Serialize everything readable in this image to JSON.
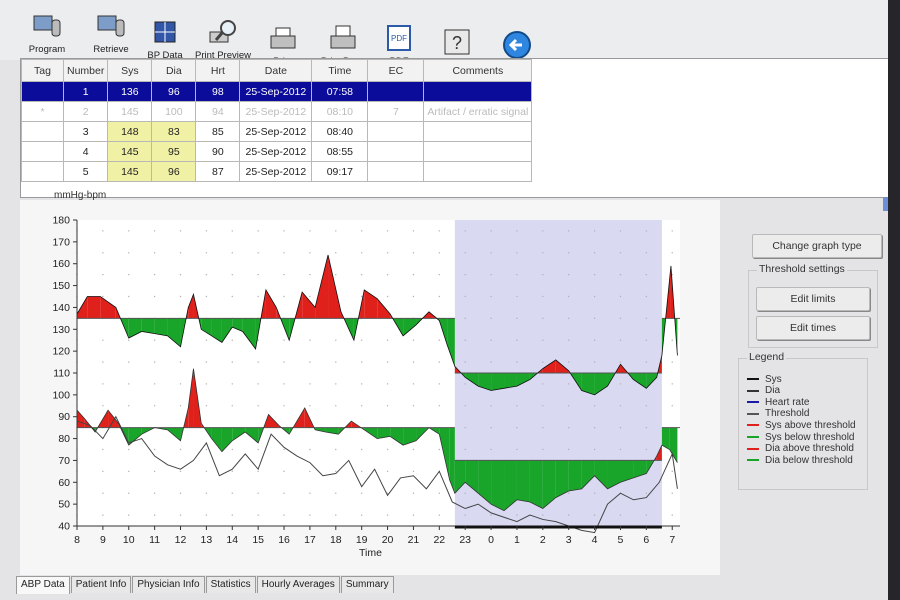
{
  "toolbar": {
    "buttons": [
      {
        "label": "Program",
        "icon": "program-icon"
      },
      {
        "label": "Retrieve",
        "icon": "retrieve-icon"
      },
      {
        "label": "BP Data",
        "icon": "bp-data-icon"
      },
      {
        "label": "Print Preview",
        "icon": "print-preview-icon"
      },
      {
        "label": "Print",
        "icon": "print-icon"
      },
      {
        "label": "Print Page",
        "icon": "print-page-icon"
      },
      {
        "label": "PDF",
        "icon": "pdf-icon"
      },
      {
        "label": "Help",
        "icon": "help-icon"
      },
      {
        "label": "Exit",
        "icon": "exit-icon"
      }
    ]
  },
  "table": {
    "columns": [
      "Tag",
      "Number",
      "Sys",
      "Dia",
      "Hrt",
      "Date",
      "Time",
      "EC",
      "Comments"
    ],
    "rows": [
      {
        "tag": "",
        "number": "1",
        "sys": "136",
        "dia": "96",
        "hrt": "98",
        "date": "25-Sep-2012",
        "time": "07:58",
        "ec": "",
        "comment": "",
        "state": "selected"
      },
      {
        "tag": "*",
        "number": "2",
        "sys": "145",
        "dia": "100",
        "hrt": "94",
        "date": "25-Sep-2012",
        "time": "08:10",
        "ec": "7",
        "comment": "Artifact / erratic signal",
        "state": "faded"
      },
      {
        "tag": "",
        "number": "3",
        "sys": "148",
        "dia": "83",
        "hrt": "85",
        "date": "25-Sep-2012",
        "time": "08:40",
        "ec": "",
        "comment": "",
        "state": "normal"
      },
      {
        "tag": "",
        "number": "4",
        "sys": "145",
        "dia": "95",
        "hrt": "90",
        "date": "25-Sep-2012",
        "time": "08:55",
        "ec": "",
        "comment": "",
        "state": "normal"
      },
      {
        "tag": "",
        "number": "5",
        "sys": "145",
        "dia": "96",
        "hrt": "87",
        "date": "25-Sep-2012",
        "time": "09:17",
        "ec": "",
        "comment": "",
        "state": "normal"
      }
    ]
  },
  "colors": {
    "above": "#e0201b",
    "below": "#19a52a",
    "sys": "#111111",
    "dia": "#333333",
    "heart_rate": "#1a1aa8",
    "threshold": "#555555",
    "night_band": "#d9d9f2",
    "selected_row": "#0b0c9a",
    "highlight_cell": "#f1f1a6"
  },
  "chart_data": {
    "type": "area",
    "ylabel": "mmHg-bpm",
    "xlabel": "Time",
    "ylim": [
      40,
      180
    ],
    "yticks": [
      40,
      50,
      60,
      70,
      80,
      90,
      100,
      110,
      120,
      130,
      140,
      150,
      160,
      170,
      180
    ],
    "xlim": [
      8,
      31.3
    ],
    "xtick_values": [
      8,
      9,
      10,
      11,
      12,
      13,
      14,
      15,
      16,
      17,
      18,
      19,
      20,
      21,
      22,
      23,
      24,
      25,
      26,
      27,
      28,
      29,
      30,
      31
    ],
    "xtick_labels": [
      "8",
      "9",
      "10",
      "11",
      "12",
      "13",
      "14",
      "15",
      "16",
      "17",
      "18",
      "19",
      "20",
      "21",
      "22",
      "23",
      "0",
      "1",
      "2",
      "3",
      "4",
      "5",
      "6",
      "7"
    ],
    "night_period": [
      22.6,
      30.6
    ],
    "thresholds": [
      {
        "series": "Sys",
        "segments": [
          {
            "x": [
              8,
              22.6
            ],
            "y": 135
          },
          {
            "x": [
              22.6,
              30.6
            ],
            "y": 110
          },
          {
            "x": [
              30.6,
              31.3
            ],
            "y": 135
          }
        ]
      },
      {
        "series": "Dia",
        "segments": [
          {
            "x": [
              8,
              22.6
            ],
            "y": 85
          },
          {
            "x": [
              22.6,
              30.6
            ],
            "y": 70
          },
          {
            "x": [
              30.6,
              31.3
            ],
            "y": 85
          }
        ]
      }
    ],
    "series": [
      {
        "name": "Sys",
        "x": [
          8,
          8.4,
          8.9,
          9.5,
          10,
          10.5,
          11,
          11.5,
          12,
          12.3,
          12.5,
          12.8,
          13.2,
          13.6,
          14,
          14.4,
          14.9,
          15.3,
          15.7,
          16.2,
          16.7,
          17.2,
          17.7,
          18.2,
          18.7,
          19.1,
          19.6,
          20.1,
          20.6,
          21.1,
          21.6,
          22,
          22.3,
          22.6,
          23,
          23.5,
          24,
          24.5,
          25,
          25.5,
          26,
          26.5,
          27,
          27.5,
          28,
          28.5,
          29,
          29.5,
          30,
          30.4,
          30.6,
          30.95,
          31.2
        ],
        "y": [
          137,
          145,
          145,
          140,
          126,
          129,
          128,
          127,
          122,
          140,
          146,
          130,
          127,
          124,
          131,
          129,
          121,
          148,
          140,
          125,
          147,
          140,
          164,
          138,
          125,
          148,
          144,
          137,
          127,
          132,
          138,
          134,
          123,
          113,
          108,
          104,
          102,
          103,
          104,
          107,
          112,
          116,
          111,
          102,
          100,
          104,
          114,
          107,
          103,
          108,
          118,
          159,
          118
        ]
      },
      {
        "name": "Dia",
        "x": [
          8,
          8.3,
          8.7,
          9.2,
          9.6,
          10,
          10.5,
          11,
          11.5,
          12,
          12.3,
          12.5,
          12.8,
          13.2,
          13.6,
          14,
          14.5,
          15,
          15.4,
          15.8,
          16.2,
          16.8,
          17.2,
          17.6,
          18.1,
          18.6,
          19.1,
          19.6,
          20.1,
          20.6,
          21.1,
          21.6,
          22,
          22.4,
          22.6,
          23,
          23.5,
          24,
          24.5,
          25,
          25.5,
          26,
          26.5,
          27,
          27.5,
          28,
          28.5,
          29,
          29.5,
          30,
          30.4,
          30.6,
          30.9,
          31.2
        ],
        "y": [
          93,
          89,
          83,
          93,
          87,
          77,
          82,
          85,
          84,
          79,
          94,
          112,
          87,
          80,
          74,
          79,
          83,
          78,
          91,
          86,
          82,
          94,
          84,
          83,
          82,
          88,
          84,
          80,
          81,
          77,
          79,
          85,
          82,
          61,
          55,
          60,
          55,
          50,
          47,
          52,
          51,
          48,
          53,
          56,
          57,
          63,
          57,
          60,
          62,
          64,
          72,
          77,
          75,
          69
        ]
      },
      {
        "name": "Heart rate",
        "x": [
          8,
          8.5,
          9,
          9.5,
          10,
          10.5,
          11,
          11.5,
          12,
          12.5,
          13,
          13.5,
          14,
          14.5,
          15,
          15.5,
          16,
          16.5,
          17,
          17.5,
          18,
          18.5,
          19,
          19.5,
          20,
          20.5,
          21,
          21.5,
          22,
          22.5,
          23,
          23.5,
          24,
          24.5,
          25,
          25.5,
          26,
          26.5,
          27,
          27.5,
          28,
          28.5,
          29,
          29.5,
          30,
          30.5,
          31,
          31.2
        ],
        "y": [
          88,
          86,
          80,
          90,
          78,
          80,
          72,
          68,
          66,
          70,
          78,
          63,
          66,
          73,
          66,
          82,
          76,
          72,
          69,
          63,
          64,
          70,
          58,
          66,
          54,
          62,
          63,
          57,
          65,
          51,
          48,
          50,
          46,
          44,
          42,
          45,
          43,
          42,
          40,
          38,
          37,
          50,
          55,
          52,
          53,
          60,
          73,
          57
        ]
      }
    ]
  },
  "right_panel": {
    "change_graph_button": "Change graph type",
    "threshold_title": "Threshold settings",
    "edit_limits_button": "Edit limits",
    "edit_times_button": "Edit times",
    "legend_title": "Legend",
    "legend": [
      {
        "label": "Sys",
        "color": "#111111"
      },
      {
        "label": "Dia",
        "color": "#333333"
      },
      {
        "label": "Heart rate",
        "color": "#1a1aa8"
      },
      {
        "label": "Threshold",
        "color": "#555555"
      },
      {
        "label": "Sys above threshold",
        "color": "#e0201b"
      },
      {
        "label": "Sys below threshold",
        "color": "#19a52a"
      },
      {
        "label": "Dia above threshold",
        "color": "#e0201b"
      },
      {
        "label": "Dia below threshold",
        "color": "#19a52a"
      }
    ]
  },
  "tabs": [
    "ABP Data",
    "Patient Info",
    "Physician Info",
    "Statistics",
    "Hourly Averages",
    "Summary"
  ],
  "active_tab": "ABP Data"
}
